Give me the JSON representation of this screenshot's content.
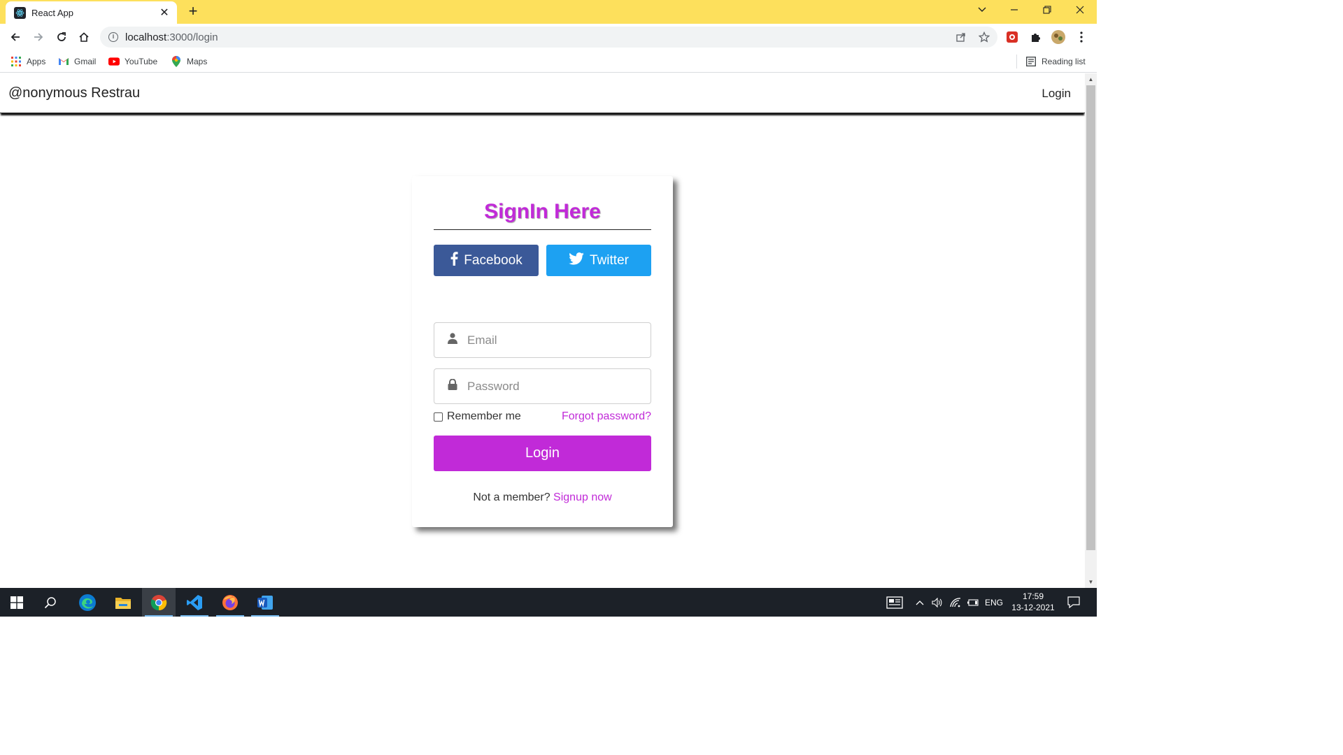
{
  "browser": {
    "tab_title": "React App",
    "tab_close": "✕",
    "new_tab": "+",
    "url_host": "localhost",
    "url_path": ":3000/login",
    "window_controls": {
      "dropdown": "⌄",
      "minimize": "─",
      "restore": "❐",
      "close": "✕"
    }
  },
  "bookmarks": [
    {
      "label": "Apps",
      "icon": "apps-grid-icon"
    },
    {
      "label": "Gmail",
      "icon": "gmail-icon"
    },
    {
      "label": "YouTube",
      "icon": "youtube-icon"
    },
    {
      "label": "Maps",
      "icon": "maps-pin-icon"
    }
  ],
  "reading_list": "Reading list",
  "navbar": {
    "brand": "@nonymous Restrau",
    "login": "Login"
  },
  "signin": {
    "title": "SignIn Here",
    "facebook": "Facebook",
    "twitter": "Twitter",
    "email_placeholder": "Email",
    "password_placeholder": "Password",
    "remember": "Remember me",
    "forgot": "Forgot password?",
    "login_button": "Login",
    "not_member": "Not a member?",
    "signup": "Signup now"
  },
  "colors": {
    "accent": "#c12ad8",
    "facebook": "#3b5998",
    "twitter": "#1da1f2",
    "titlebar": "#fde05c"
  },
  "taskbar": {
    "lang": "ENG",
    "time": "17:59",
    "date": "13-12-2021",
    "apps": [
      "start-icon",
      "search-icon",
      "edge-icon",
      "file-explorer-icon",
      "chrome-icon",
      "vscode-icon",
      "firefox-icon",
      "word-icon"
    ]
  }
}
